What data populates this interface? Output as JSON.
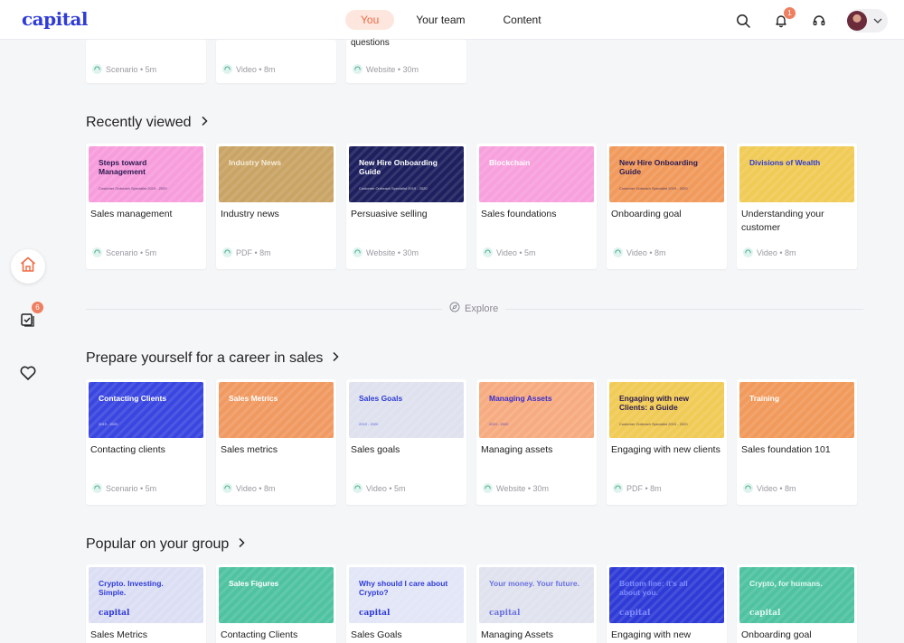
{
  "brand": "capital",
  "nav": [
    {
      "label": "You",
      "active": true
    },
    {
      "label": "Your team",
      "active": false
    },
    {
      "label": "Content",
      "active": false
    }
  ],
  "header": {
    "notifications": "1"
  },
  "rail": {
    "tasks_count": "6"
  },
  "partial_row": [
    {
      "title": "",
      "meta": "Scenario • 5m"
    },
    {
      "title": "",
      "meta": "Video • 8m"
    },
    {
      "title": "questions",
      "meta": "Website • 30m"
    }
  ],
  "sections": {
    "recently_viewed": {
      "title": "Recently viewed",
      "cards": [
        {
          "thumb_text": "Steps toward Management",
          "thumb_sub": "Customer Outreach Specialist  2019 - 2020",
          "title": "Sales management",
          "meta": "Scenario • 5m",
          "bg": "#f79ddc",
          "fg": "#2a1a50"
        },
        {
          "thumb_text": "Industry News",
          "thumb_sub": "",
          "title": "Industry news",
          "meta": "PDF • 8m",
          "bg": "#c9a465",
          "fg": "#f6ecd8"
        },
        {
          "thumb_text": "New Hire Onboarding Guide",
          "thumb_sub": "Customer Outreach Specialist  2019 - 2020",
          "title": "Persuasive selling",
          "meta": "Website • 30m",
          "bg": "#1d1f5e",
          "fg": "#ffffff"
        },
        {
          "thumb_text": "Blockchain",
          "thumb_sub": "",
          "title": "Sales foundations",
          "meta": "Video • 5m",
          "bg": "#f7a0dd",
          "fg": "#ffffff"
        },
        {
          "thumb_text": "New Hire Onboarding Guide",
          "thumb_sub": "Customer Outreach Specialist  2019 - 2020",
          "title": "Onboarding goal",
          "meta": "Video • 8m",
          "bg": "#f19a5c",
          "fg": "#2a1a50"
        },
        {
          "thumb_text": "Divisions of Wealth",
          "thumb_sub": "",
          "title": "Understanding your customer",
          "meta": "Video • 8m",
          "bg": "#f0cb56",
          "fg": "#2f3bd6"
        }
      ]
    },
    "explore": "Explore",
    "career": {
      "title": "Prepare yourself for a career in sales",
      "cards": [
        {
          "thumb_text": "Contacting Clients",
          "thumb_sub": "2019 - 2020",
          "title": "Contacting clients",
          "meta": "Scenario • 5m",
          "bg": "#3a46e0",
          "fg": "#ffffff"
        },
        {
          "thumb_text": "Sales Metrics",
          "thumb_sub": "",
          "title": "Sales metrics",
          "meta": "Video • 8m",
          "bg": "#f09a62",
          "fg": "#ffffff"
        },
        {
          "thumb_text": "Sales Goals",
          "thumb_sub": "2019 - 2020",
          "title": "Sales goals",
          "meta": "Video • 5m",
          "bg": "#dfe2ee",
          "fg": "#2f3bd6"
        },
        {
          "thumb_text": "Managing Assets",
          "thumb_sub": "2019 - 2020",
          "title": "Managing assets",
          "meta": "Website • 30m",
          "bg": "#f6ab80",
          "fg": "#3b2fd0"
        },
        {
          "thumb_text": "Engaging with new Clients: a Guide",
          "thumb_sub": "Customer Outreach Specialist  2019 - 2020",
          "title": "Engaging with new clients",
          "meta": "PDF • 8m",
          "bg": "#f0cb56",
          "fg": "#2a1a50"
        },
        {
          "thumb_text": "Training",
          "thumb_sub": "",
          "title": "Sales foundation 101",
          "meta": "Video • 8m",
          "bg": "#f19a5c",
          "fg": "#ffffff"
        }
      ]
    },
    "popular": {
      "title": "Popular on your group",
      "cards": [
        {
          "thumb_text": "Crypto. Investing. Simple.",
          "thumb_sub": "capital",
          "title": "Sales Metrics",
          "bg": "#dcdff4",
          "fg": "#2f3bd6"
        },
        {
          "thumb_text": "Sales Figures",
          "thumb_sub": "",
          "title": "Contacting Clients",
          "bg": "#4fc3a1",
          "fg": "#ffffff"
        },
        {
          "thumb_text": "Why should I care about Crypto?",
          "thumb_sub": "capital",
          "title": "Sales Goals",
          "bg": "#e2e6f6",
          "fg": "#2f3bd6"
        },
        {
          "thumb_text": "Your money. Your future.",
          "thumb_sub": "capital",
          "title": "Managing Assets",
          "bg": "#e0e2ee",
          "fg": "#6a72e0"
        },
        {
          "thumb_text": "Bottom line: it's all about you.",
          "thumb_sub": "capital",
          "title": "Engaging with new",
          "bg": "#2f3bd6",
          "fg": "#7f8cff"
        },
        {
          "thumb_text": "Crypto, for humans.",
          "thumb_sub": "capital",
          "title": "Onboarding goal",
          "bg": "#4fc3a1",
          "fg": "#dff7ef"
        }
      ]
    }
  },
  "colors": {
    "brand": "#2f3bd6",
    "accent": "#ee6a43"
  }
}
